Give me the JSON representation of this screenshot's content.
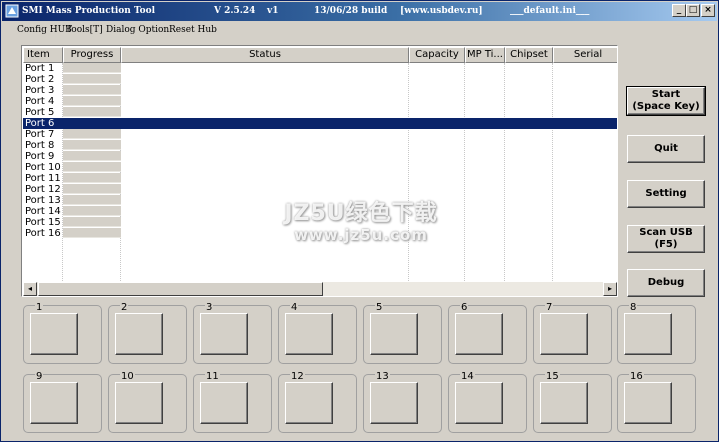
{
  "titlebar": {
    "app_name": "SMI Mass Production Tool",
    "version": "V 2.5.24",
    "revision": "v1",
    "build": "13/06/28 build",
    "site": "[www.usbdev.ru]",
    "ini_file": "___default.ini___",
    "min_glyph": "_",
    "max_glyph": "□",
    "close_glyph": "×"
  },
  "menu": {
    "items": [
      "Config HUB",
      "Tools[T]",
      "Dialog Option",
      "Reset Hub"
    ]
  },
  "list": {
    "columns": [
      "Item",
      "Progress",
      "Status",
      "Capacity",
      "MP Ti...",
      "Chipset",
      "Serial"
    ],
    "rows": [
      "Port 1",
      "Port 2",
      "Port 3",
      "Port 4",
      "Port 5",
      "Port 6",
      "Port 7",
      "Port 8",
      "Port 9",
      "Port 10",
      "Port 11",
      "Port 12",
      "Port 13",
      "Port 14",
      "Port 15",
      "Port 16"
    ],
    "selected_row": "Port 6",
    "scroll_left_glyph": "◂",
    "scroll_right_glyph": "▸"
  },
  "buttons": {
    "start": "Start\n(Space Key)",
    "quit": "Quit",
    "setting": "Setting",
    "scan_usb": "Scan USB\n(F5)",
    "debug": "Debug"
  },
  "ports": [
    "1",
    "2",
    "3",
    "4",
    "5",
    "6",
    "7",
    "8",
    "9",
    "10",
    "11",
    "12",
    "13",
    "14",
    "15",
    "16"
  ],
  "watermark": {
    "line1": "JZ5U绿色下载",
    "line2": "www.jz5u.com"
  },
  "colors": {
    "selection": "#0a246a",
    "titlebar": "#0a246a",
    "face": "#d4d0c8"
  }
}
